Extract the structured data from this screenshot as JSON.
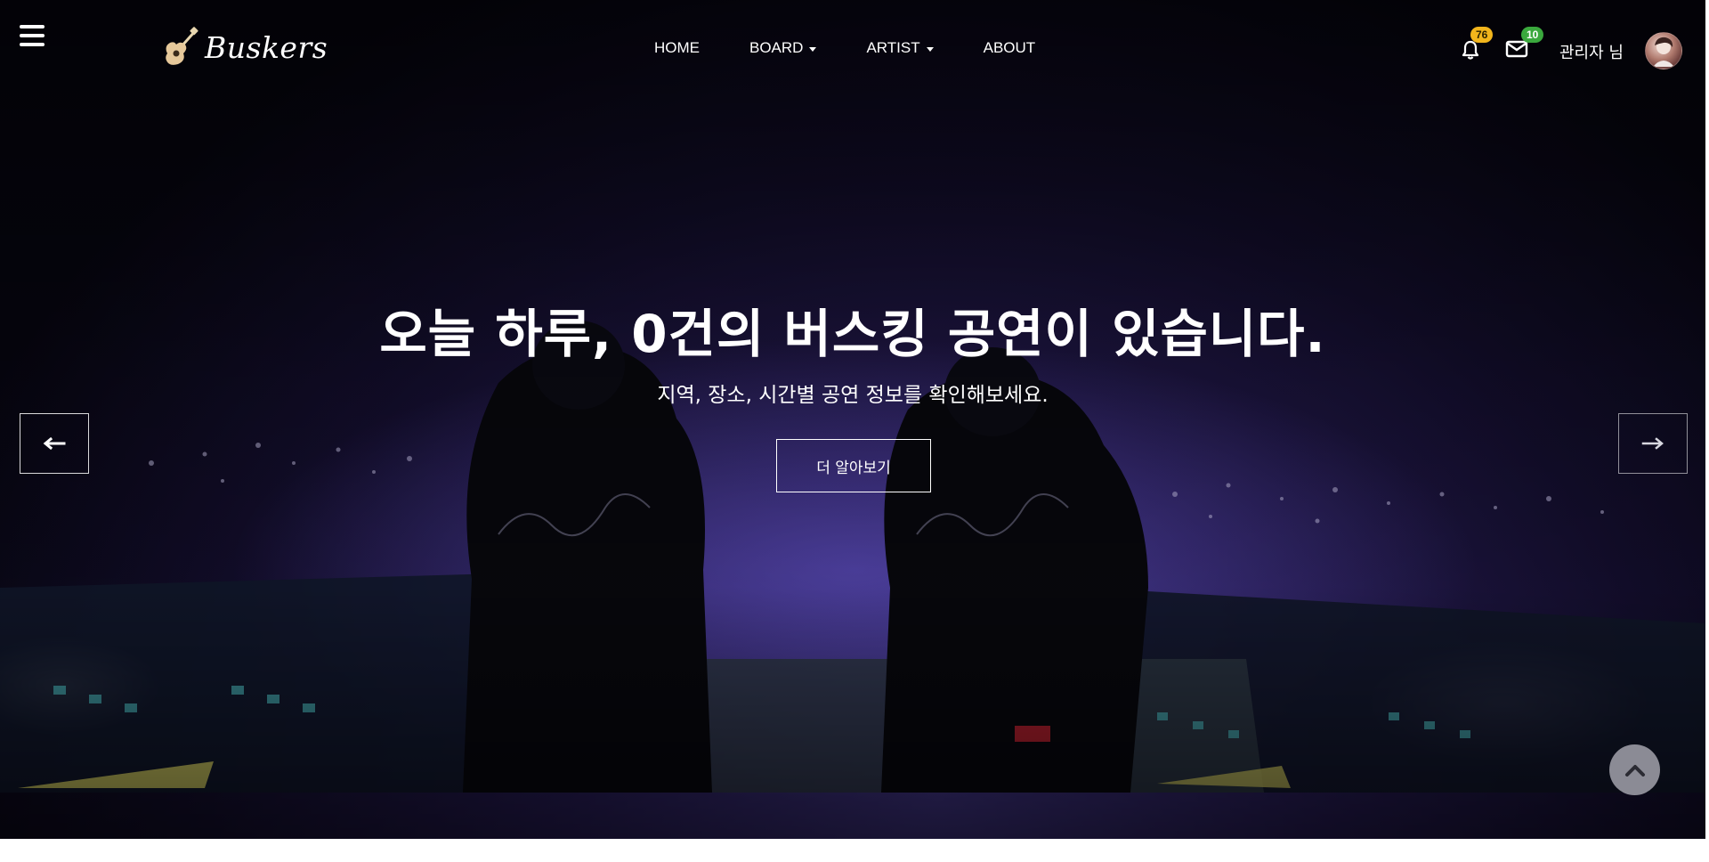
{
  "header": {
    "logo_text": "Buskers",
    "nav": [
      {
        "label": "HOME",
        "has_dropdown": false
      },
      {
        "label": "BOARD",
        "has_dropdown": true
      },
      {
        "label": "ARTIST",
        "has_dropdown": true
      },
      {
        "label": "ABOUT",
        "has_dropdown": false
      }
    ],
    "notifications_count": "76",
    "messages_count": "10",
    "username": "관리자 님"
  },
  "hero": {
    "title": "오늘 하루, 0건의 버스킹 공연이 있습니다.",
    "subtitle": "지역, 장소, 시간별 공연 정보를 확인해보세요.",
    "cta_label": "더 알아보기"
  },
  "colors": {
    "badge_notifications": "#f2b51c",
    "badge_messages": "#3aa83d",
    "hero_background": "#0b0920"
  },
  "icons": {
    "menu": "hamburger-icon",
    "logo": "guitar-icon",
    "notifications": "bell-icon",
    "messages": "envelope-icon",
    "prev": "arrow-left-icon",
    "next": "arrow-right-icon",
    "scroll_top": "chevron-up-icon"
  }
}
